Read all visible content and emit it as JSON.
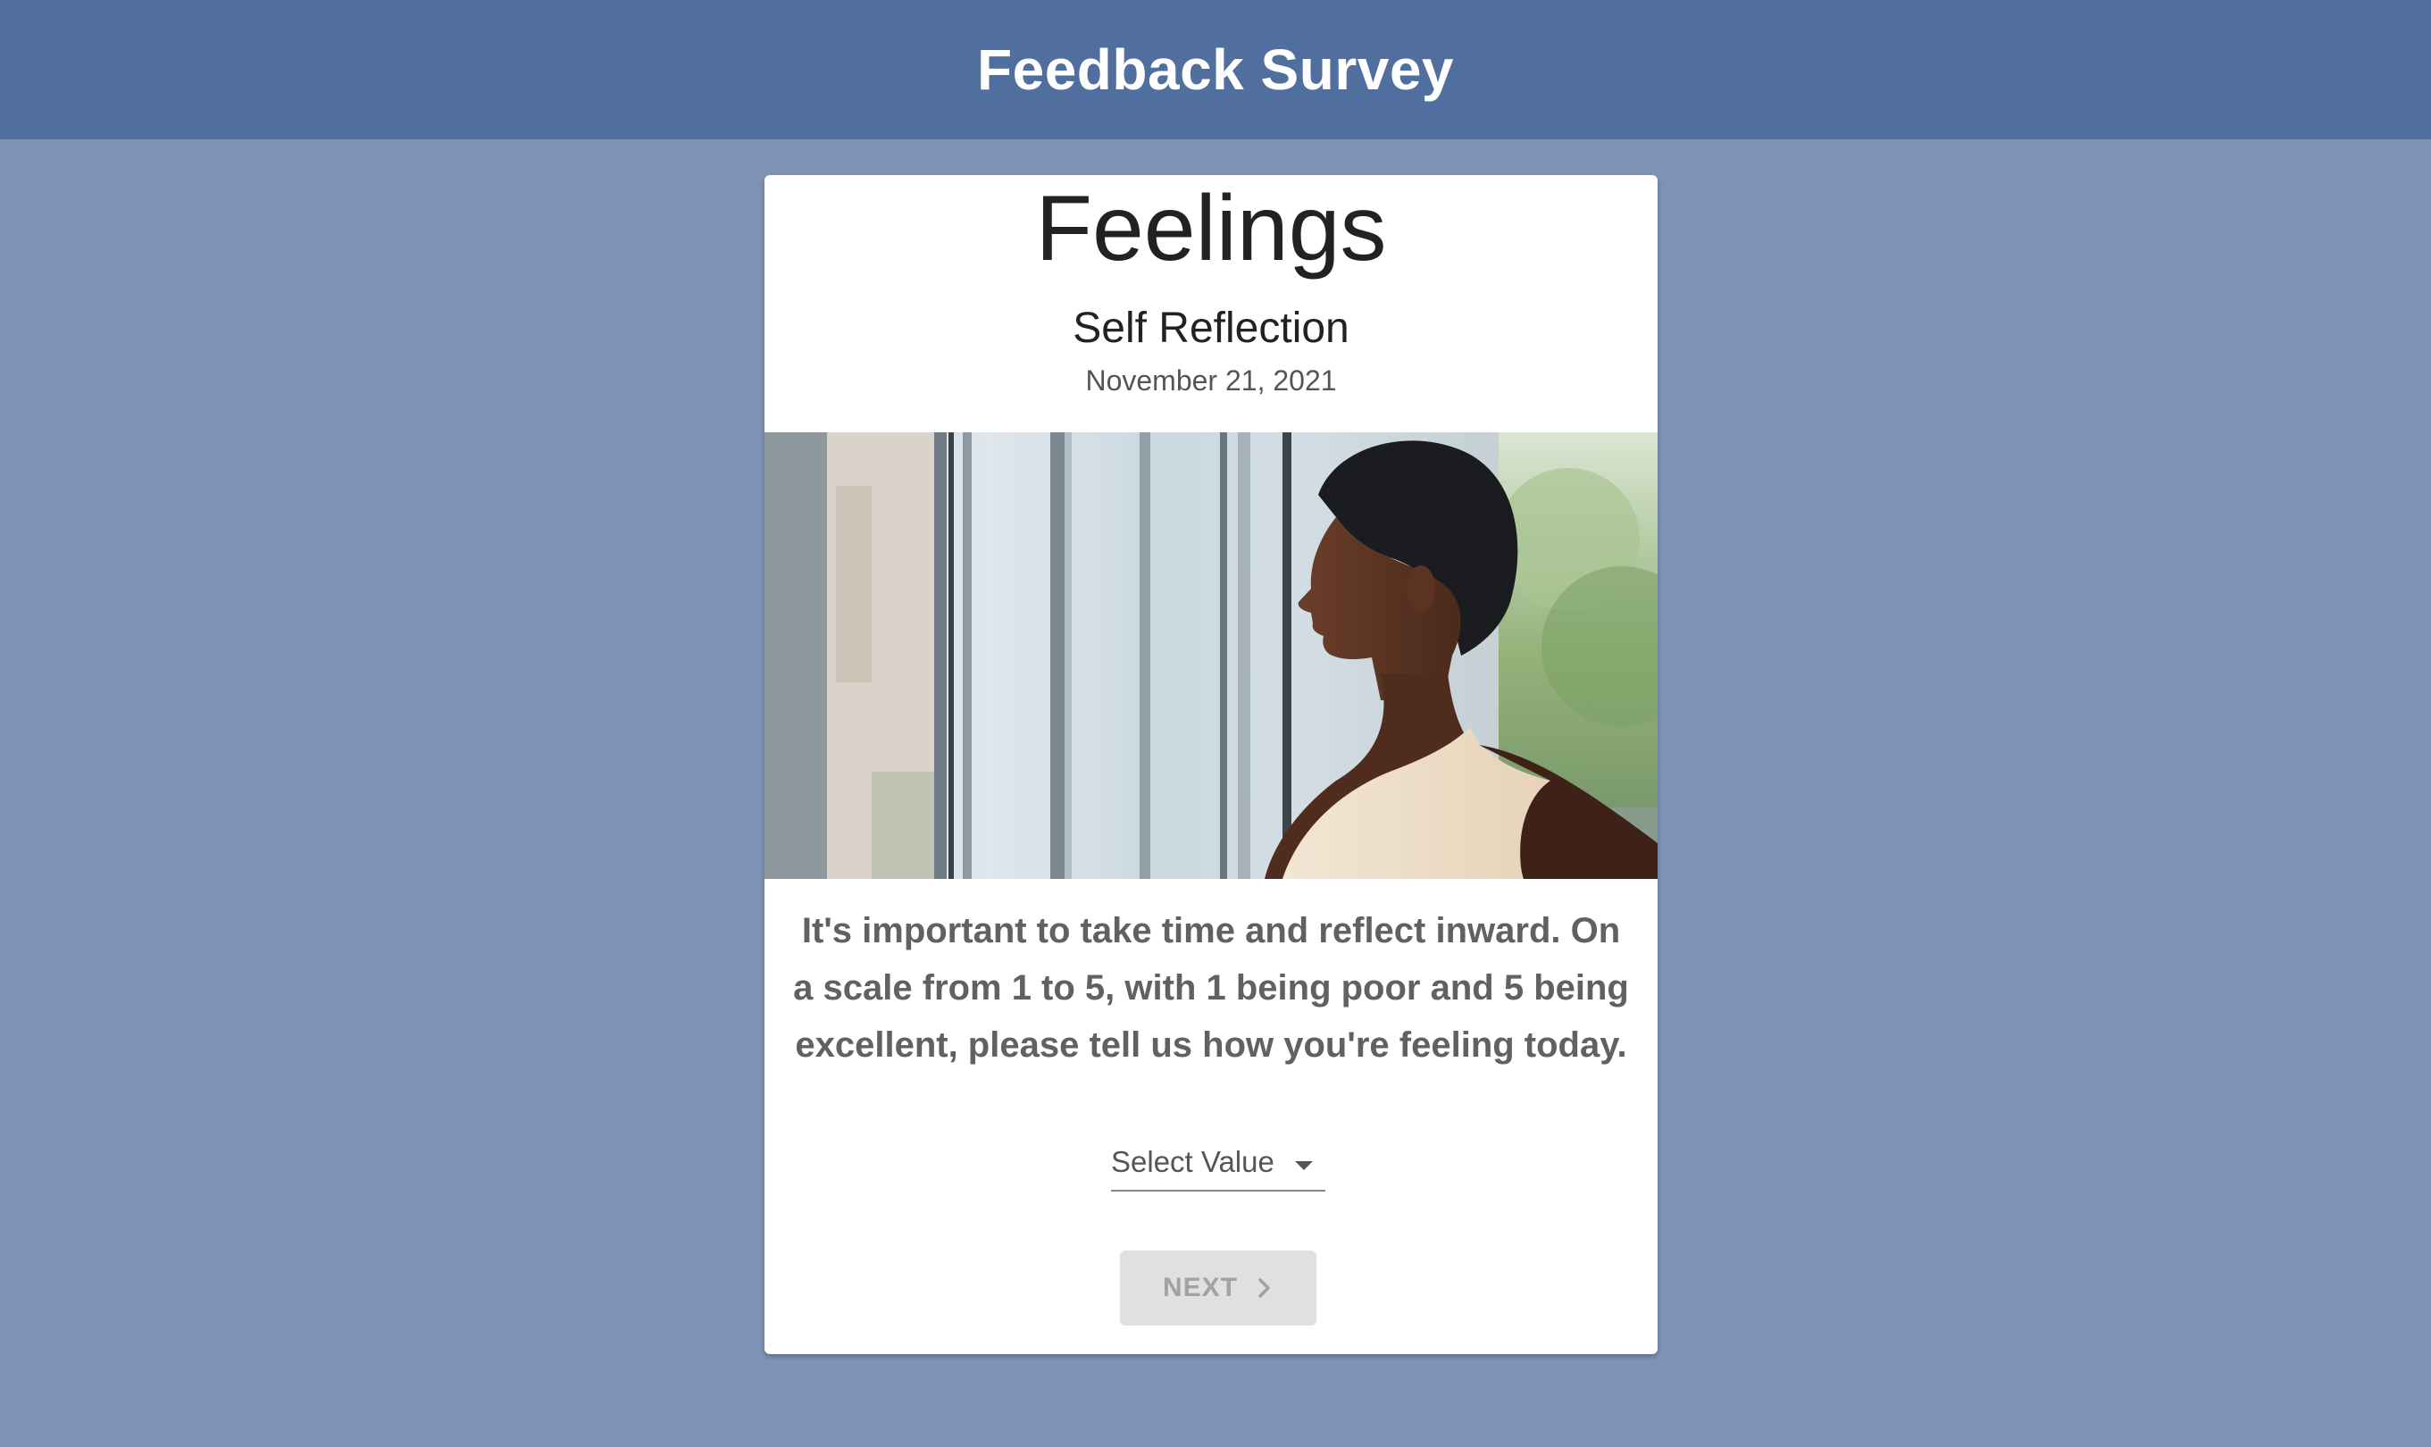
{
  "header": {
    "title": "Feedback Survey"
  },
  "card": {
    "title": "Feelings",
    "subtitle": "Self Reflection",
    "date": "November 21, 2021",
    "prompt": "It's important to take time and reflect inward. On a scale from 1 to 5, with 1 being poor and 5 being excellent, please tell us how you're feeling today.",
    "select": {
      "placeholder": "Select Value",
      "icon": "caret-down-icon"
    },
    "next_button": {
      "label": "NEXT",
      "icon": "chevron-right-icon",
      "disabled": true
    }
  },
  "colors": {
    "page_background": "#7f93b7",
    "header_background": "#506f9f",
    "card_background": "#ffffff",
    "button_disabled": "#e0e0e0"
  }
}
